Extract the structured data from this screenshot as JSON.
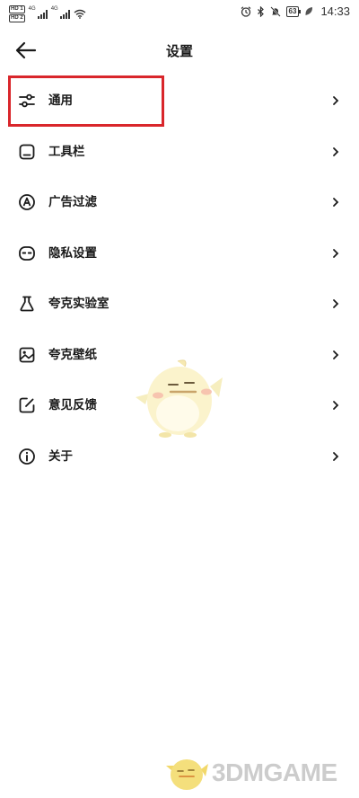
{
  "status_bar": {
    "hd1": "HD 1",
    "hd2": "HD 2",
    "network_1": "4G",
    "network_2": "4G",
    "battery": "63",
    "time": "14:33"
  },
  "header": {
    "title": "设置"
  },
  "settings": [
    {
      "label": "通用",
      "icon": "sliders-icon"
    },
    {
      "label": "工具栏",
      "icon": "toolbar-icon"
    },
    {
      "label": "广告过滤",
      "icon": "ad-filter-icon"
    },
    {
      "label": "隐私设置",
      "icon": "privacy-mask-icon"
    },
    {
      "label": "夸克实验室",
      "icon": "flask-icon"
    },
    {
      "label": "夸克壁纸",
      "icon": "image-icon"
    },
    {
      "label": "意见反馈",
      "icon": "edit-icon"
    },
    {
      "label": "关于",
      "icon": "info-icon"
    }
  ],
  "highlighted_item": "通用",
  "colors": {
    "highlight_border": "#d9262b",
    "text": "#1a1a1a",
    "mascot_body": "#fbf3cc"
  },
  "watermark": {
    "text": "3DMGAME"
  }
}
